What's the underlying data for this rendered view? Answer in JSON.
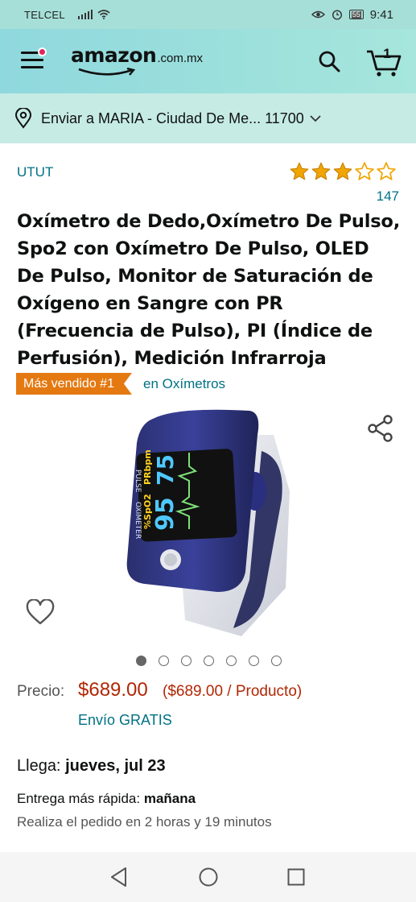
{
  "status_bar": {
    "carrier": "TELCEL",
    "battery": "55",
    "time": "9:41"
  },
  "header": {
    "logo_text": "amazon",
    "logo_tld": ".com.mx",
    "cart_count": "1",
    "menu_badge_color": "#e0245e"
  },
  "delivery": {
    "text": "Enviar a MARIA - Ciudad De Me... 11700"
  },
  "product": {
    "brand": "UTUT",
    "rating": 3,
    "rating_max": 5,
    "review_count": "147",
    "title": "Oxímetro de Dedo,Oxímetro De Pulso, Spo2 con Oxímetro De Pulso, OLED De Pulso, Monitor de Saturación de Oxígeno en Sangre con PR (Frecuencia de Pulso), PI (Índice de Perfusión), Medición Infrarroja",
    "badge": "Más vendido #1",
    "badge_category": "en Oxímetros",
    "image_count": 7,
    "image_active_index": 0,
    "device_screen": {
      "spo2_label": "%SpO2",
      "spo2_value": "95",
      "pr_label": "PRbpm",
      "pr_value": "75",
      "device_label_1": "PULSE",
      "device_label_2": "OXIMETER"
    }
  },
  "pricing": {
    "label": "Precio:",
    "price": "$689.00",
    "unit_price": "($689.00 / Producto)",
    "shipping": "Envío GRATIS"
  },
  "delivery_info": {
    "arrives_label": "Llega:",
    "arrives_date": "jueves, jul 23",
    "fastest_label": "Entrega más rápida:",
    "fastest_date": "mañana",
    "order_within": "Realiza el pedido en 2 horas y 19 minutos"
  },
  "colors": {
    "header_bg": "#a6e6dc",
    "link": "#007185",
    "price": "#b12704",
    "badge": "#e47911",
    "star": "#f0a500"
  }
}
